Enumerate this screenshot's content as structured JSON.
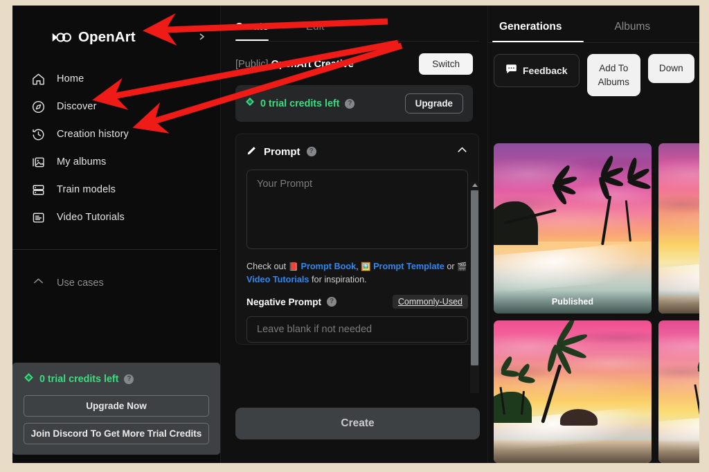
{
  "brand": {
    "name": "OpenArt",
    "logo_icon": "infinity-logo-icon"
  },
  "sidebar": {
    "items": [
      {
        "label": "Home",
        "icon": "home-icon"
      },
      {
        "label": "Discover",
        "icon": "compass-icon"
      },
      {
        "label": "Creation history",
        "icon": "history-icon"
      },
      {
        "label": "My albums",
        "icon": "albums-icon"
      },
      {
        "label": "Train models",
        "icon": "server-icon"
      },
      {
        "label": "Video Tutorials",
        "icon": "article-icon"
      }
    ],
    "use_cases": {
      "label": "Use cases",
      "icon": "chevron-up-icon"
    },
    "credits": {
      "text": "0 trial credits left",
      "gem_icon": "gem-icon",
      "help_icon": "?",
      "upgrade_label": "Upgrade Now",
      "discord_label": "Join Discord To Get More Trial Credits"
    }
  },
  "center": {
    "tabs": [
      {
        "label": "Create",
        "active": true
      },
      {
        "label": "Edit",
        "active": false
      }
    ],
    "model": {
      "visibility": "[Public]",
      "name": "OpenArt Creative",
      "switch_label": "Switch"
    },
    "credits_banner": {
      "text": "0 trial credits left",
      "gem_icon": "gem-icon",
      "help_icon": "?",
      "upgrade_label": "Upgrade"
    },
    "prompt": {
      "title": "Prompt",
      "pencil_icon": "pencil-icon",
      "help_icon": "?",
      "collapse_icon": "chevron-up-icon",
      "value": "",
      "placeholder": "Your Prompt"
    },
    "checkout": {
      "prefix": "Check out",
      "link1": "Prompt Book",
      "separator": ",",
      "link2": "Prompt Template",
      "mid": "or",
      "link3": "Video Tutorials",
      "suffix": "for inspiration."
    },
    "negative_prompt": {
      "title": "Negative Prompt",
      "help_icon": "?",
      "commonly_used_label": "Commonly-Used",
      "value": "",
      "placeholder": "Leave blank if not needed"
    },
    "create_button": "Create"
  },
  "right": {
    "tabs": [
      {
        "label": "Generations",
        "active": true
      },
      {
        "label": "Albums",
        "active": false
      }
    ],
    "actions": [
      {
        "label": "Feedback",
        "icon": "chat-icon",
        "style": "dark"
      },
      {
        "label": "Add To\nAlbums",
        "style": "light"
      },
      {
        "label": "Down",
        "style": "light"
      }
    ],
    "gallery": [
      {
        "caption": "Published",
        "alt": "palm trees silhouetted over a purple and orange sunset beach"
      },
      {
        "caption": "",
        "alt": "pink and orange sunset over tropical shoreline"
      },
      {
        "caption": "",
        "alt": "single palm tree leaning over a pink sunset beach"
      },
      {
        "caption": "",
        "alt": "palm grove on a violet sunset beach"
      }
    ]
  },
  "annotations": {
    "arrow_color": "#ee1b16",
    "arrows": [
      {
        "target": "brand-logo"
      },
      {
        "target": "sidebar-item-discover"
      },
      {
        "target": "sidebar-item-creation-history"
      }
    ]
  },
  "colors": {
    "frame": "#e9dcc6",
    "app_bg": "#0d0d0d",
    "accent_green": "#3ddc7f",
    "link_blue": "#2f87ef",
    "arrow_red": "#ee1b16"
  }
}
